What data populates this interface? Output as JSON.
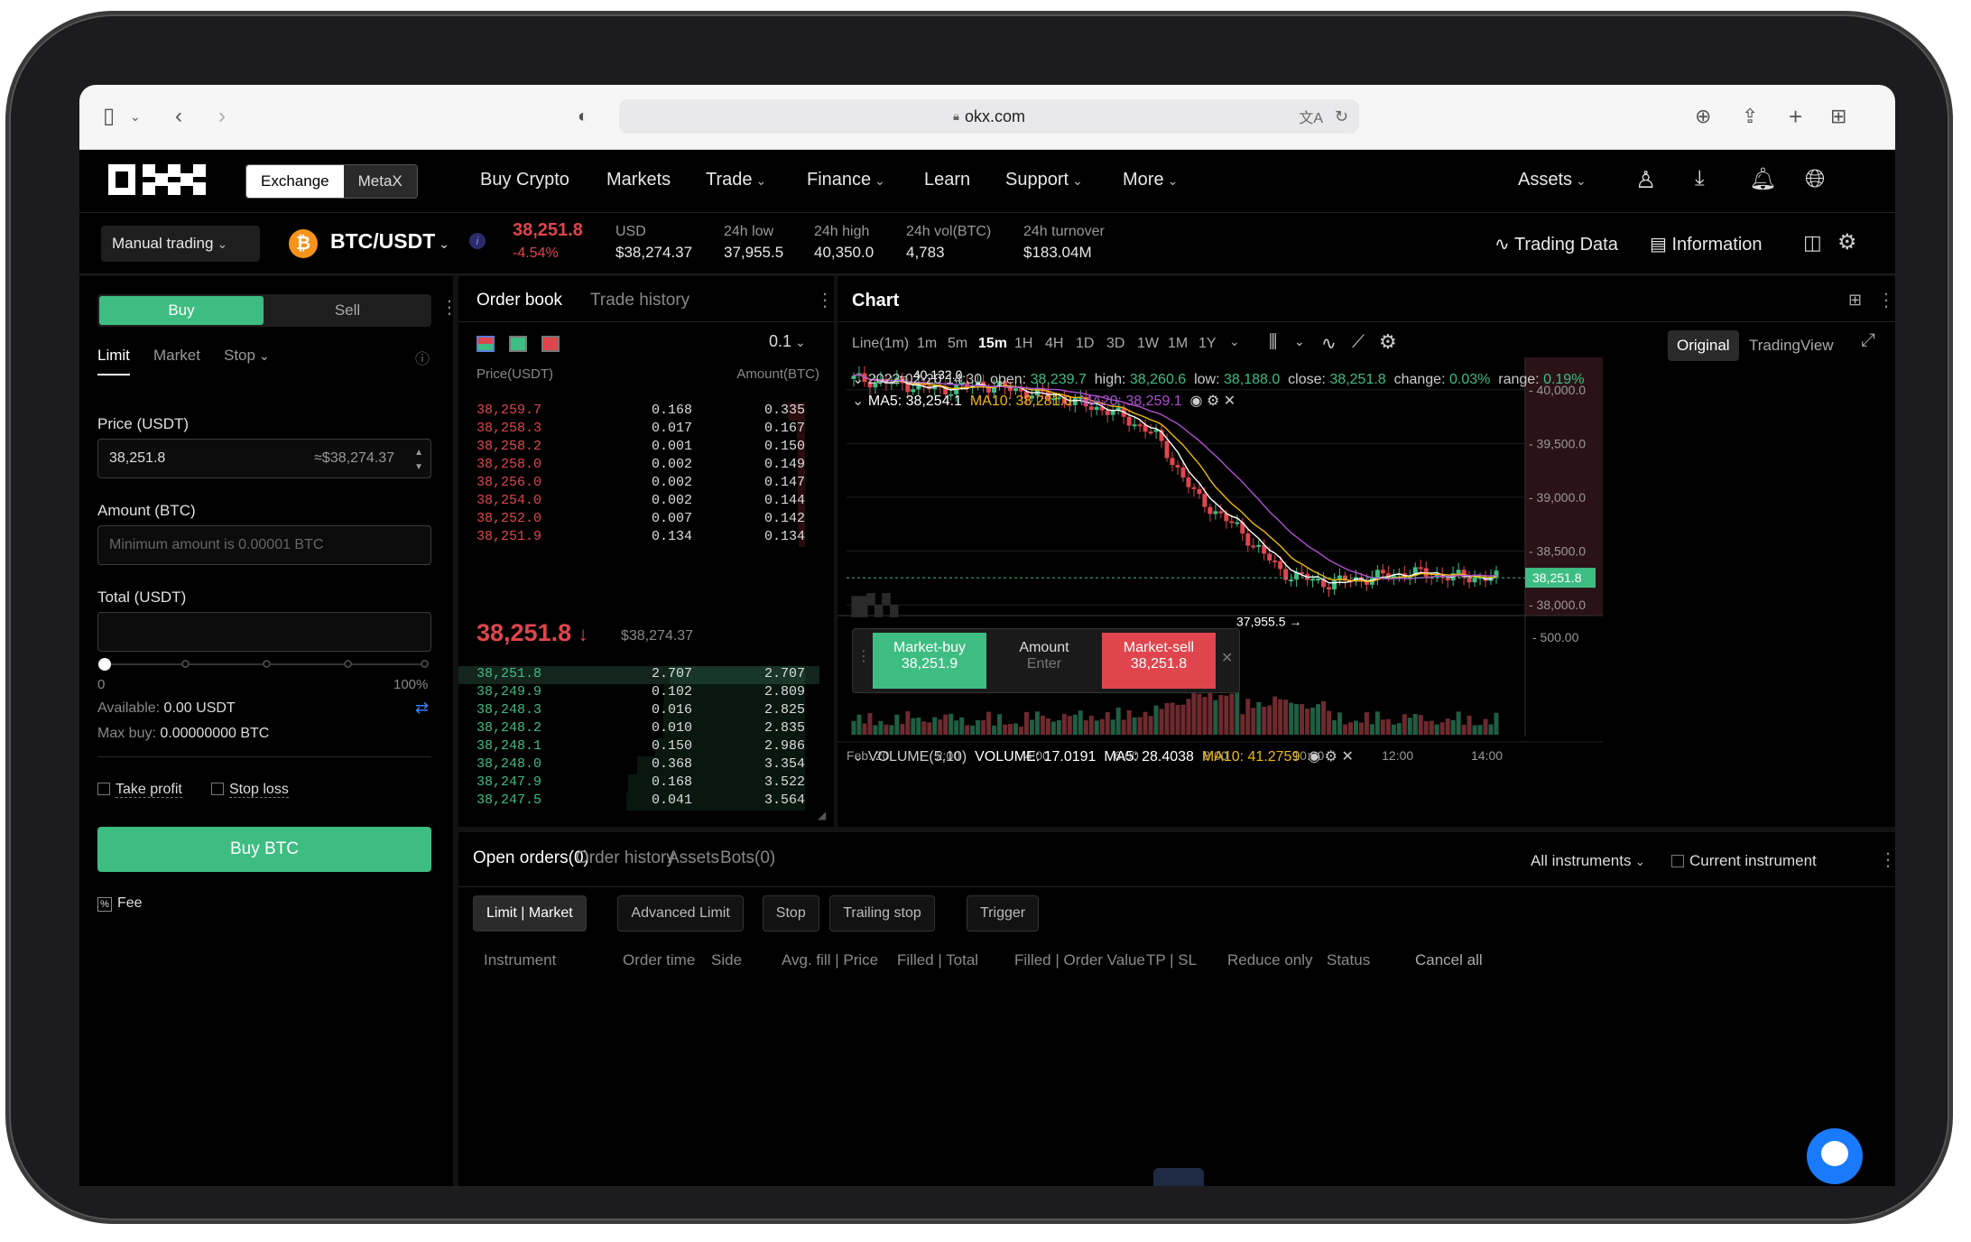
{
  "browser": {
    "url": "okx.com"
  },
  "nav": {
    "exchange": "Exchange",
    "metax": "MetaX",
    "items": [
      "Buy Crypto",
      "Markets",
      "Trade",
      "Finance",
      "Learn",
      "Support",
      "More"
    ],
    "assets": "Assets"
  },
  "ticker": {
    "mode": "Manual trading",
    "pair": "BTC/USDT",
    "price": "38,251.8",
    "change": "-4.54%",
    "usd_label": "USD",
    "usd_value": "$38,274.37",
    "low_label": "24h low",
    "low_value": "37,955.5",
    "high_label": "24h high",
    "high_value": "40,350.0",
    "vol_label": "24h vol(BTC)",
    "vol_value": "4,783",
    "turnover_label": "24h turnover",
    "turnover_value": "$183.04M",
    "trading_data": "Trading Data",
    "information": "Information"
  },
  "trade": {
    "buy": "Buy",
    "sell": "Sell",
    "types": [
      "Limit",
      "Market",
      "Stop"
    ],
    "price_label": "Price (USDT)",
    "price_value": "38,251.8",
    "price_usd": "≈$38,274.37",
    "amount_label": "Amount (BTC)",
    "amount_placeholder": "Minimum amount is 0.00001 BTC",
    "total_label": "Total (USDT)",
    "slider_min": "0",
    "slider_max": "100%",
    "available_label": "Available:",
    "available_value": "0.00 USDT",
    "maxbuy_label": "Max buy:",
    "maxbuy_value": "0.00000000 BTC",
    "take_profit": "Take profit",
    "stop_loss": "Stop loss",
    "buy_btn": "Buy BTC",
    "fee": "Fee"
  },
  "orderbook": {
    "tab1": "Order book",
    "tab2": "Trade history",
    "precision": "0.1",
    "col_price": "Price(USDT)",
    "col_amount": "Amount(BTC)",
    "asks": [
      [
        "38,259.7",
        "0.168",
        "0.335"
      ],
      [
        "38,258.3",
        "0.017",
        "0.167"
      ],
      [
        "38,258.2",
        "0.001",
        "0.150"
      ],
      [
        "38,258.0",
        "0.002",
        "0.149"
      ],
      [
        "38,256.0",
        "0.002",
        "0.147"
      ],
      [
        "38,254.0",
        "0.002",
        "0.144"
      ],
      [
        "38,252.0",
        "0.007",
        "0.142"
      ],
      [
        "38,251.9",
        "0.134",
        "0.134"
      ]
    ],
    "mid_price": "38,251.8",
    "mid_usd": "$38,274.37",
    "bids": [
      [
        "38,251.8",
        "2.707",
        "2.707"
      ],
      [
        "38,249.9",
        "0.102",
        "2.809"
      ],
      [
        "38,248.3",
        "0.016",
        "2.825"
      ],
      [
        "38,248.2",
        "0.010",
        "2.835"
      ],
      [
        "38,248.1",
        "0.150",
        "2.986"
      ],
      [
        "38,248.0",
        "0.368",
        "3.354"
      ],
      [
        "38,247.9",
        "0.168",
        "3.522"
      ],
      [
        "38,247.5",
        "0.041",
        "3.564"
      ]
    ]
  },
  "chart": {
    "title": "Chart",
    "intervals": [
      "Line(1m)",
      "1m",
      "5m",
      "15m",
      "1H",
      "4H",
      "1D",
      "3D",
      "1W",
      "1M",
      "1Y"
    ],
    "original": "Original",
    "tradingview": "TradingView",
    "info_date": "2022-02-20 14:30",
    "open_label": "open:",
    "open_value": "38,239.7",
    "high_label": "high:",
    "high_value": "38,260.6",
    "low_label": "low:",
    "low_value": "38,188.0",
    "close_label": "close:",
    "close_value": "38,251.8",
    "change_label": "change:",
    "change_value": "0.03%",
    "range_label": "range:",
    "range_value": "0.19%",
    "ma5": "MA5: 38,254.1",
    "ma10": "MA10: 38,281.0",
    "ma20": "MA20: 38,259.1",
    "high_marker": "← 40,132.0",
    "low_marker": "37,955.5 →",
    "price_tag": "38,251.8",
    "yaxis": [
      "40,000.0",
      "39,500.0",
      "39,000.0",
      "38,500.0",
      "38,000.0"
    ],
    "xaxis": [
      "Feb. 20",
      "2:00",
      "4:00",
      "6:00",
      "8:00",
      "10:00",
      "12:00",
      "14:00"
    ],
    "volume_label": "VOLUME(5,10)",
    "volume_value": "VOLUME: 17.0191",
    "vol_ma5": "MA5: 28.4038",
    "vol_ma10": "MA10: 41.2759",
    "vol_axis": "500.00",
    "quick_buy": "Market-buy",
    "quick_buy_price": "38,251.9",
    "quick_amount": "Amount",
    "quick_amount_ph": "Enter",
    "quick_sell": "Market-sell",
    "quick_sell_price": "38,251.8"
  },
  "chart_data": {
    "type": "line",
    "x": [
      "0:00",
      "1:00",
      "2:00",
      "3:00",
      "4:00",
      "5:00",
      "6:00",
      "7:00",
      "8:00",
      "9:00",
      "10:00",
      "11:00",
      "12:00",
      "13:00",
      "14:00",
      "14:30"
    ],
    "series": [
      {
        "values": [
          40100,
          40060,
          40000,
          40050,
          39980,
          39900,
          39800,
          39600,
          39000,
          38700,
          38300,
          38200,
          38250,
          38300,
          38260,
          38251.8
        ]
      }
    ],
    "ylim": [
      37900,
      40300
    ]
  },
  "orders": {
    "tabs": [
      "Open orders(0)",
      "Order history",
      "Assets",
      "Bots(0)"
    ],
    "all_instruments": "All instruments",
    "current_instrument": "Current instrument",
    "filters": [
      "Limit | Market",
      "Advanced Limit",
      "Stop",
      "Trailing stop",
      "Trigger"
    ],
    "columns": [
      "Instrument",
      "Order time",
      "Side",
      "Avg. fill | Price",
      "Filled | Total",
      "Filled | Order Value",
      "TP | SL",
      "Reduce only",
      "Status",
      "Cancel all"
    ]
  },
  "colors": {
    "green": "#3ebd82",
    "red": "#e0454d",
    "ma5": "#ffffff",
    "ma10": "#f0b90b",
    "ma20": "#b04fd0"
  }
}
